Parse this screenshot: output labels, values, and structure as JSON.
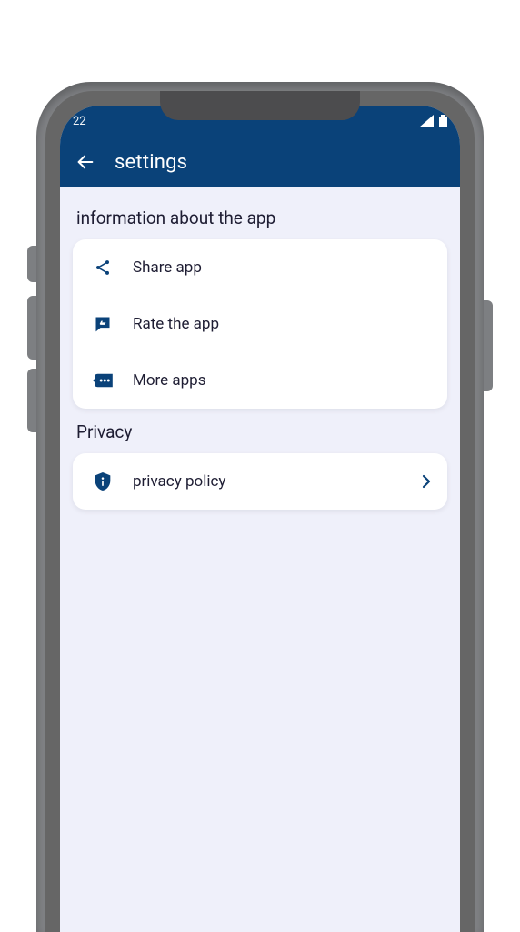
{
  "status": {
    "time_fragment": "22"
  },
  "appbar": {
    "title": "settings"
  },
  "sections": {
    "info": {
      "title": "information about the app",
      "share": "Share app",
      "rate": "Rate the app",
      "more": "More apps"
    },
    "privacy": {
      "title": "Privacy",
      "policy": "privacy policy"
    }
  },
  "colors": {
    "primary": "#0a4279",
    "background": "#eff0fa",
    "card": "#ffffff",
    "text": "#1e1d33"
  }
}
